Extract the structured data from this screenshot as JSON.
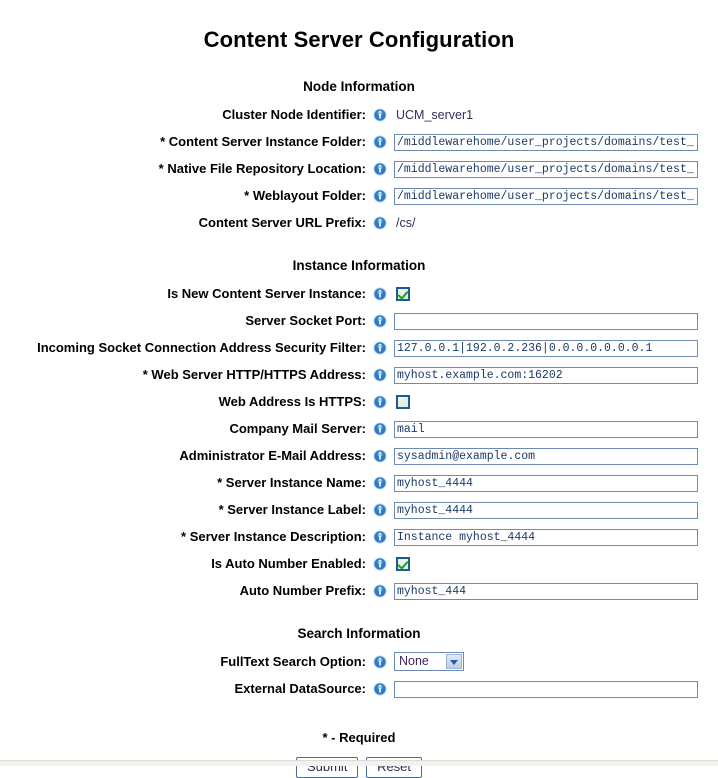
{
  "page": {
    "title": "Content Server Configuration",
    "required_note": "* - Required"
  },
  "sections": {
    "node": {
      "heading": "Node Information"
    },
    "instance": {
      "heading": "Instance Information"
    },
    "search": {
      "heading": "Search Information"
    }
  },
  "fields": {
    "cluster_node_identifier": {
      "label": "Cluster Node Identifier:",
      "value": "UCM_server1",
      "type": "static"
    },
    "content_server_instance_folder": {
      "label": "* Content Server Instance Folder:",
      "value": "/middlewarehome/user_projects/domains/test_",
      "type": "text"
    },
    "native_file_repository_location": {
      "label": "* Native File Repository Location:",
      "value": "/middlewarehome/user_projects/domains/test_",
      "type": "text"
    },
    "weblayout_folder": {
      "label": "* Weblayout Folder:",
      "value": "/middlewarehome/user_projects/domains/test_",
      "type": "text"
    },
    "content_server_url_prefix": {
      "label": "Content Server URL Prefix:",
      "value": "/cs/",
      "type": "static"
    },
    "is_new_content_server_instance": {
      "label": "Is New Content Server Instance:",
      "value": "checked",
      "type": "checkbox"
    },
    "server_socket_port": {
      "label": "Server Socket Port:",
      "value": "",
      "type": "text"
    },
    "incoming_socket_connection_address_security_filter": {
      "label": "Incoming Socket Connection Address Security Filter:",
      "value": "127.0.0.1|192.0.2.236|0.0.0.0.0.0.0.1",
      "type": "text"
    },
    "web_server_http_https_address": {
      "label": "* Web Server HTTP/HTTPS Address:",
      "value": "myhost.example.com:16202",
      "type": "text"
    },
    "web_address_is_https": {
      "label": "Web Address Is HTTPS:",
      "value": "unchecked",
      "type": "checkbox"
    },
    "company_mail_server": {
      "label": "Company Mail Server:",
      "value": "mail",
      "type": "text"
    },
    "administrator_email_address": {
      "label": "Administrator E-Mail Address:",
      "value": "sysadmin@example.com",
      "type": "text"
    },
    "server_instance_name": {
      "label": "* Server Instance Name:",
      "value": "myhost_4444",
      "type": "text"
    },
    "server_instance_label": {
      "label": "* Server Instance Label:",
      "value": "myhost_4444",
      "type": "text"
    },
    "server_instance_description": {
      "label": "* Server Instance Description:",
      "value": "Instance myhost_4444",
      "type": "text"
    },
    "is_auto_number_enabled": {
      "label": "Is Auto Number Enabled:",
      "value": "checked",
      "type": "checkbox"
    },
    "auto_number_prefix": {
      "label": "Auto Number Prefix:",
      "value": "myhost_444",
      "type": "text"
    },
    "fulltext_search_option": {
      "label": "FullText Search Option:",
      "value": "None",
      "type": "select",
      "options": [
        "None"
      ]
    },
    "external_datasource": {
      "label": "External DataSource:",
      "value": "",
      "type": "text"
    }
  },
  "buttons": {
    "submit": "Submit",
    "reset": "Reset"
  },
  "icons": {
    "info": "info-icon"
  },
  "colors": {
    "info_icon_blue": "#2e7bc4",
    "input_border": "#6f8ab0",
    "input_text": "#1a3a66",
    "static_text": "#3b2a5a",
    "checkbox_border": "#1d5c8e",
    "check_green": "#1f9e2a"
  }
}
